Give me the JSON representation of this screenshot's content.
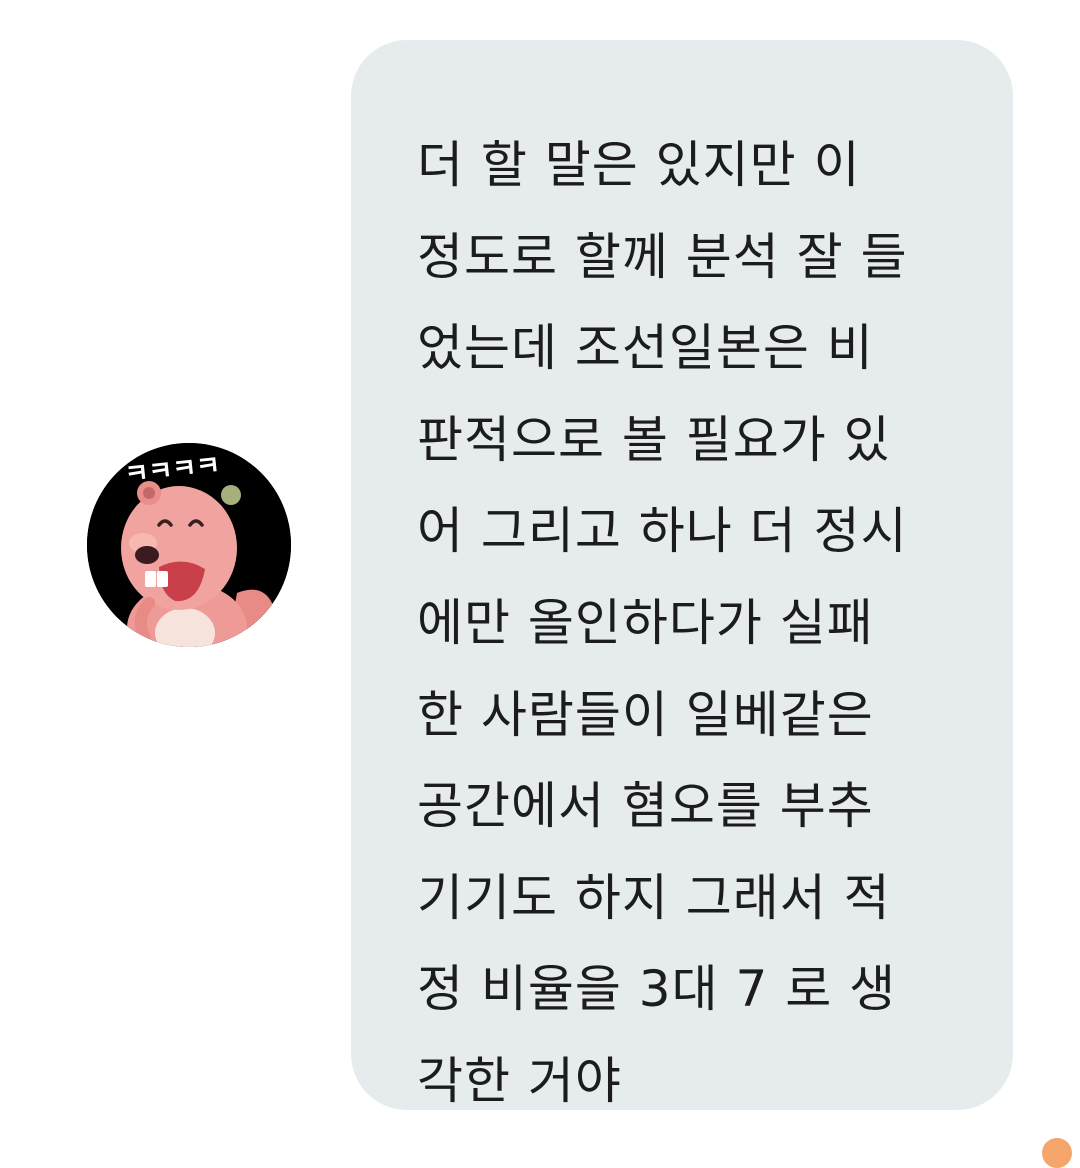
{
  "sender": {
    "avatar_icon": "pink-beaver-character-avatar",
    "avatar_caption": "ㅋㅋㅋㅋ"
  },
  "message": {
    "lines": [
      "더 할 말은 있지만 이",
      "정도로 할께 분석 잘 들",
      "었는데 조선일본은 비",
      "판적으로 볼 필요가 있",
      "어 그리고 하나 더 정시",
      "에만 올인하다가 실패",
      "한 사람들이 일베같은",
      "공간에서 혐오를 부추",
      "기기도 하지 그래서 적",
      "정 비율을 3대 7 로 생",
      "각한 거야"
    ],
    "bubble_color": "#e6ebee",
    "text_color": "#1c1c1e"
  }
}
